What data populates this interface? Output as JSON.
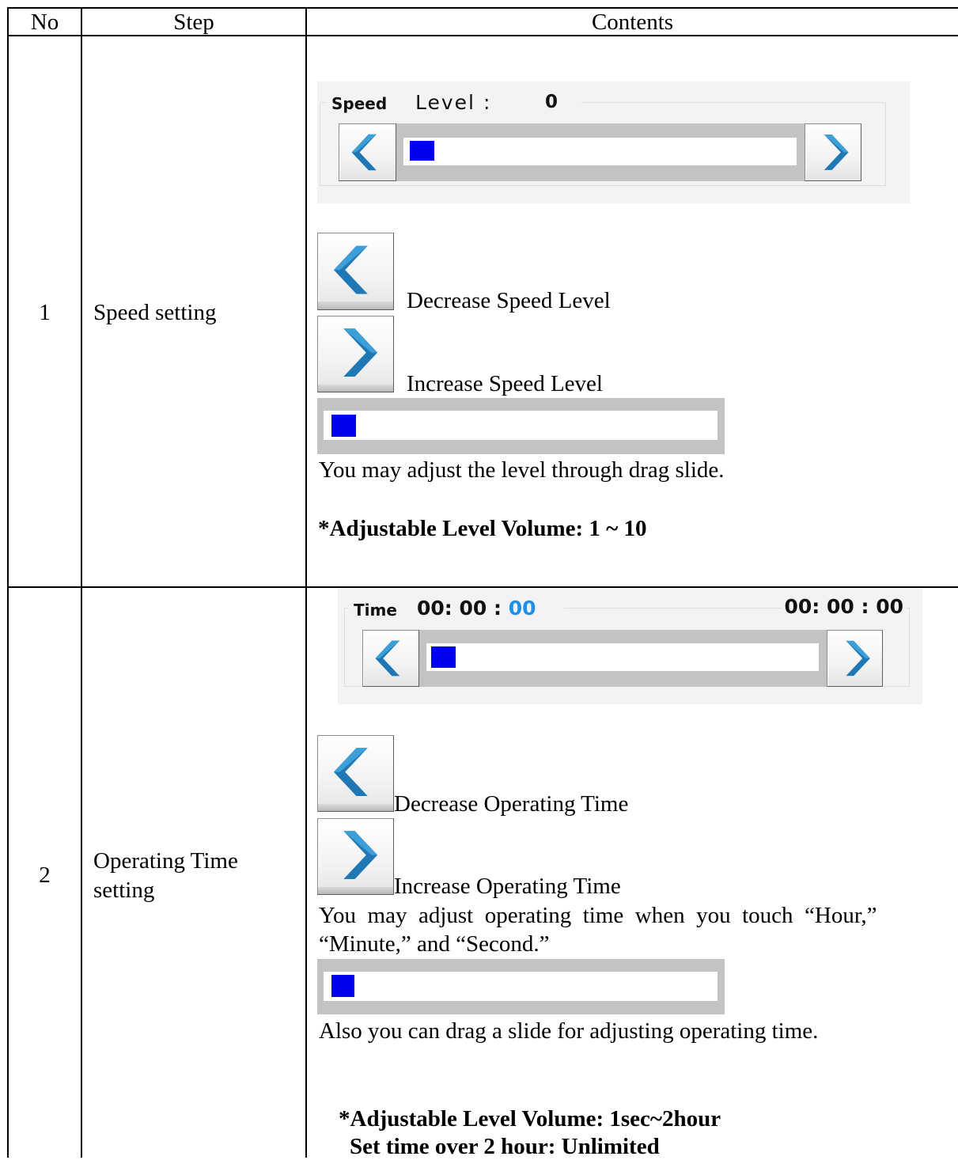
{
  "table": {
    "headers": {
      "no": "No",
      "step": "Step",
      "contents": "Contents"
    }
  },
  "rows": [
    {
      "no": "1",
      "step": "Speed setting",
      "panel": {
        "label": "Speed",
        "level_text": "Level :",
        "level_value": "0"
      },
      "decrease_text": "Decrease Speed Level",
      "increase_text": "Increase Speed Level",
      "drag_text": "You may adjust the level through drag slide.",
      "note": "*Adjustable Level Volume: 1 ~ 10"
    },
    {
      "no": "2",
      "step_line1": "Operating Time",
      "step_line2": "setting",
      "panel": {
        "label": "Time",
        "time_hm": "00: 00 :",
        "time_sec": "00",
        "total_time": "00: 00 : 00"
      },
      "decrease_text": "Decrease Operating Time",
      "increase_text": "Increase Operating Time",
      "touch_text_line1": "You  may  adjust  operating  time  when  you  touch  “Hour,”",
      "touch_text_line2": "“Minute,” and “Second.”",
      "drag_text": "Also you can drag a slide for adjusting operating time.",
      "note_line1": "*Adjustable Level Volume: 1sec~2hour",
      "note_line2": "Set time over 2 hour: Unlimited"
    }
  ],
  "colors": {
    "thumb": "#0000ee",
    "seconds": "#1e8fe8",
    "arrow": "#1f78b4"
  },
  "icons": {
    "decrease": "chevron-left-icon",
    "increase": "chevron-right-icon"
  }
}
